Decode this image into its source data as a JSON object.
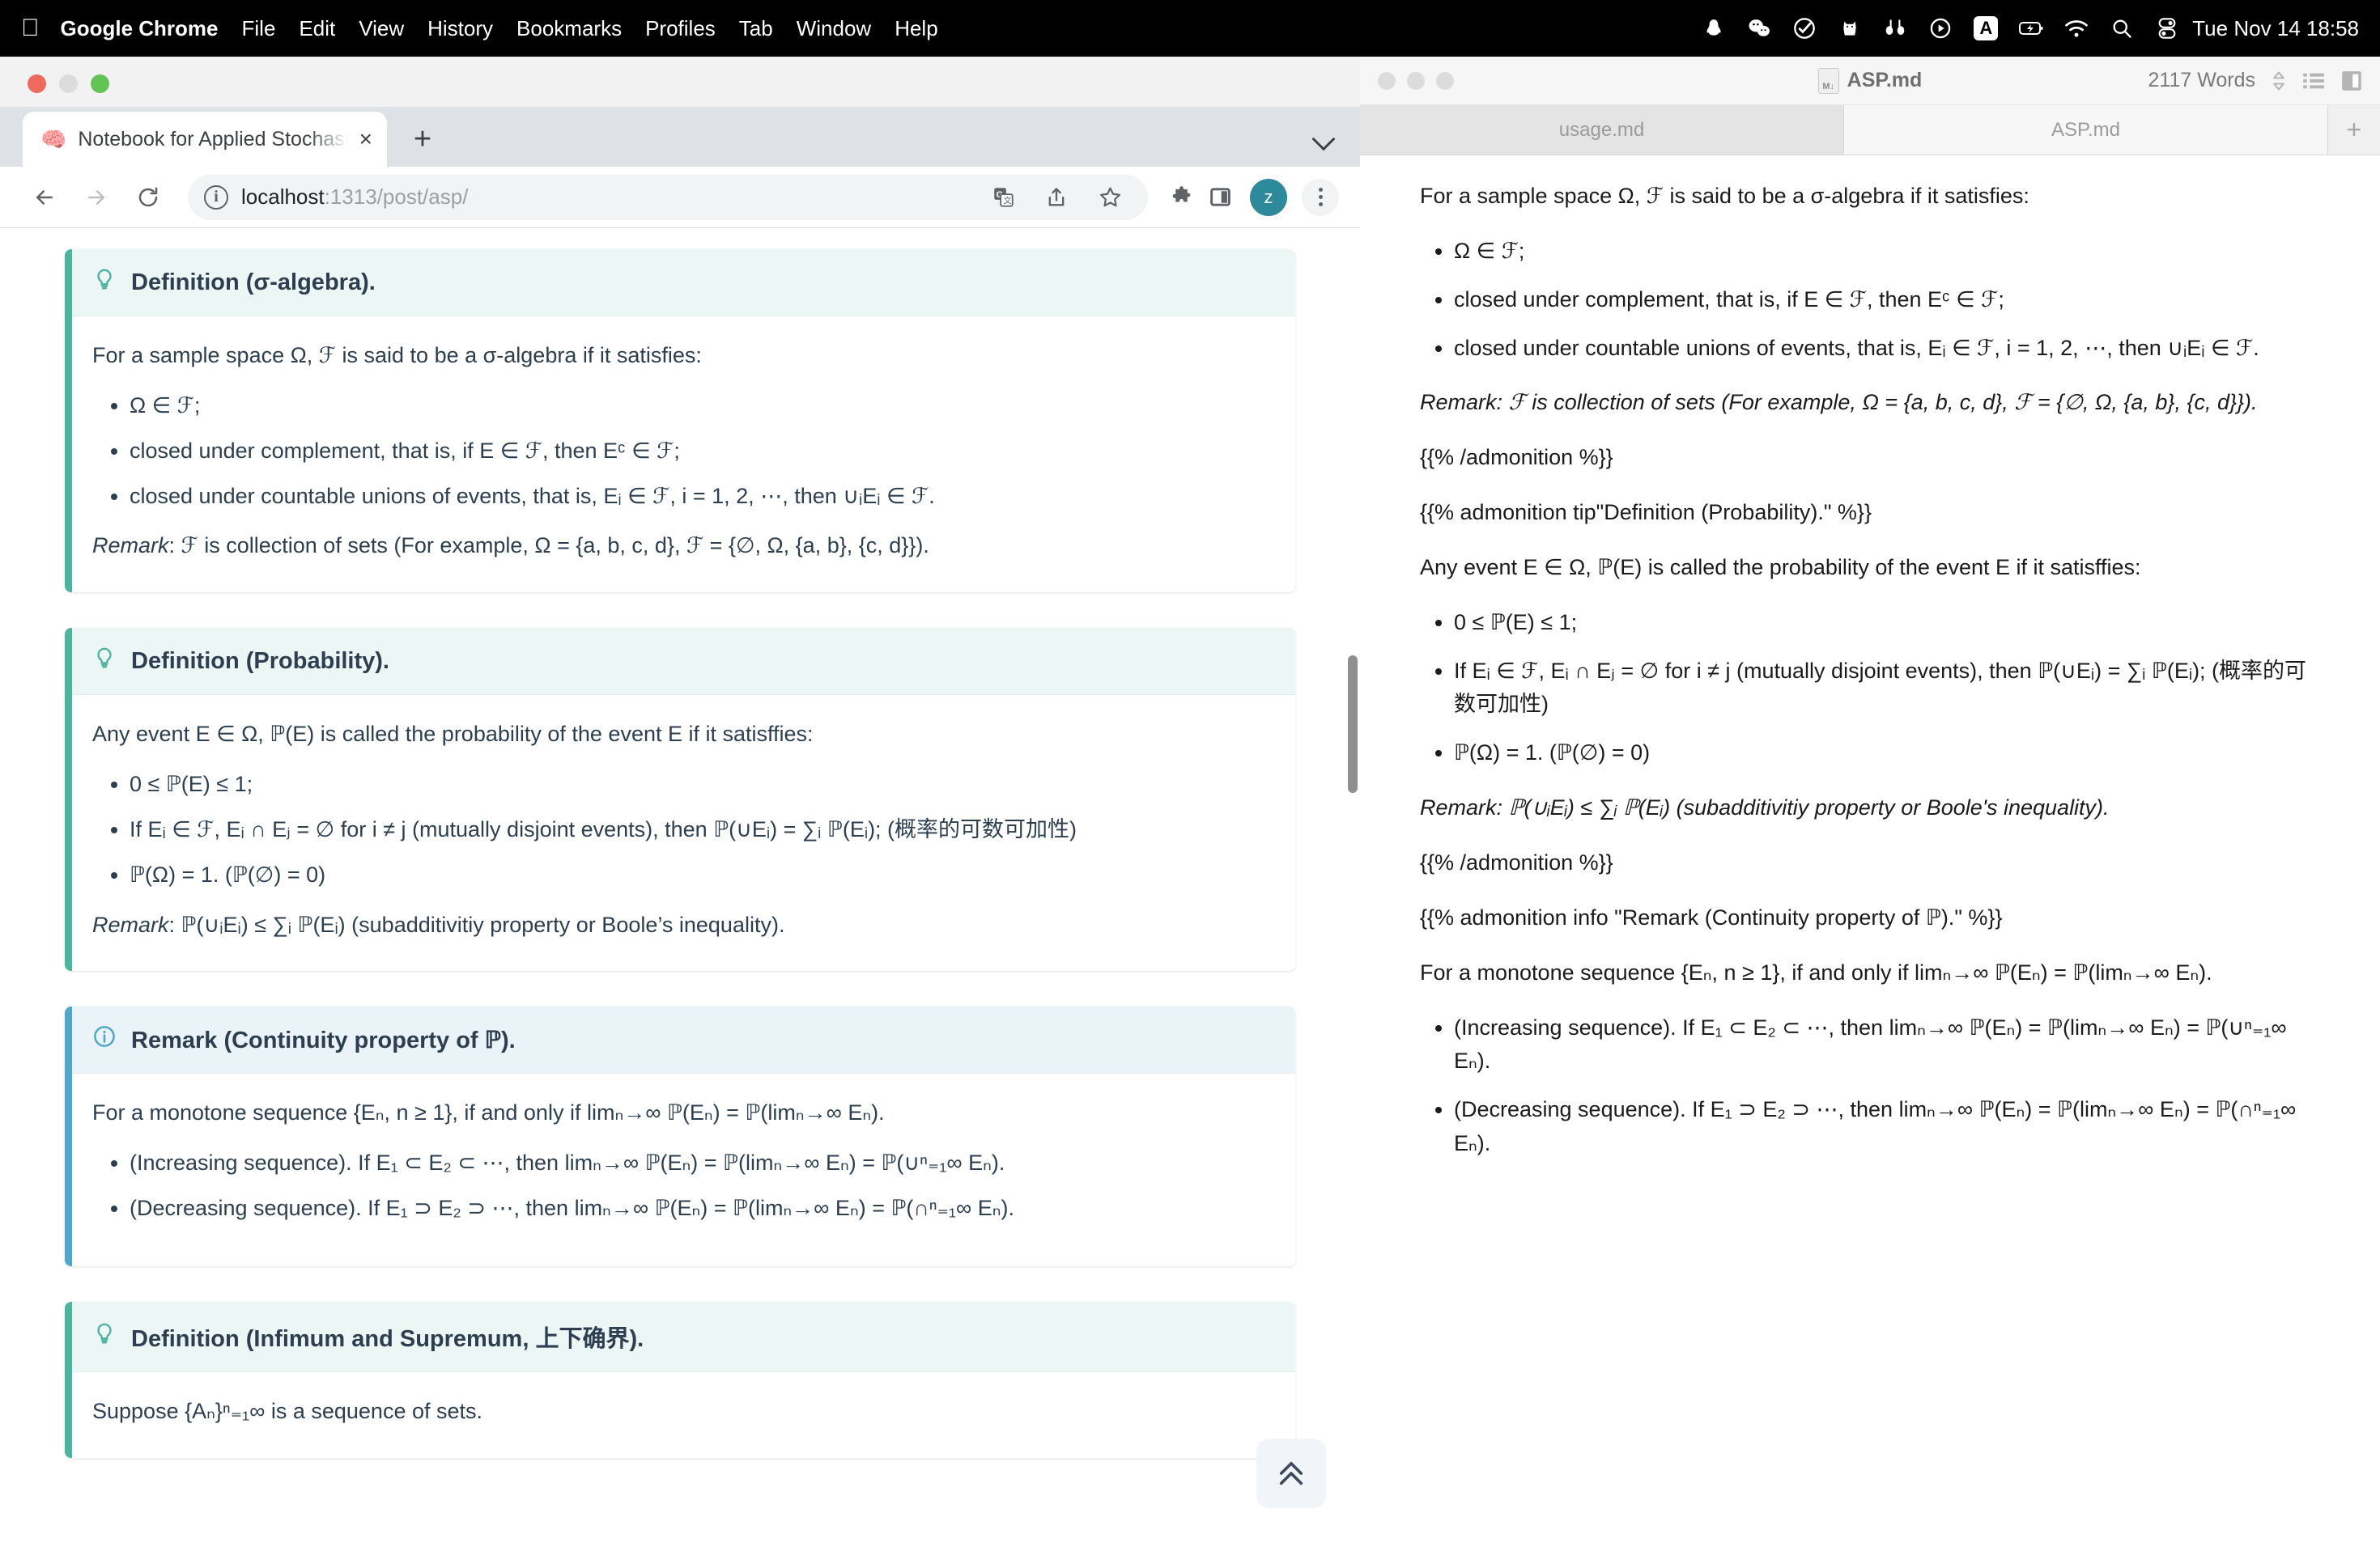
{
  "menubar": {
    "apple_icon": "apple-icon",
    "items": [
      {
        "label": "Google Chrome",
        "bold": true
      },
      {
        "label": "File",
        "bold": false
      },
      {
        "label": "Edit",
        "bold": false
      },
      {
        "label": "View",
        "bold": false
      },
      {
        "label": "History",
        "bold": false
      },
      {
        "label": "Bookmarks",
        "bold": false
      },
      {
        "label": "Profiles",
        "bold": false
      },
      {
        "label": "Tab",
        "bold": false
      },
      {
        "label": "Window",
        "bold": false
      },
      {
        "label": "Help",
        "bold": false
      }
    ],
    "tray_icons": [
      "qq-penguin-icon",
      "wechat-icon",
      "checkmark-circle-icon",
      "cat-icon",
      "earbuds-icon",
      "play-circle-icon",
      "input-source-a-icon",
      "battery-charging-icon",
      "wifi-icon",
      "spotlight-search-icon",
      "control-center-icon"
    ],
    "input_source": "A",
    "clock": "Tue Nov 14  18:58"
  },
  "chrome": {
    "tab": {
      "favicon": "brain-icon",
      "title": "Notebook for Applied Stochast",
      "close_label": "×"
    },
    "new_tab_label": "+",
    "tabstrip_chevron": "⌄",
    "toolbar": {
      "back": "←",
      "forward": "→",
      "reload": "↻",
      "url_host": "localhost",
      "url_path": ":1313/post/asp/",
      "icons": [
        "translate-icon",
        "share-icon",
        "bookmark-star-icon",
        "extensions-puzzle-icon",
        "side-panel-icon"
      ],
      "avatar_initial": "z"
    }
  },
  "page": {
    "blocks": [
      {
        "kind": "tip",
        "icon": "lightbulb-icon",
        "title": "Definition (σ-algebra).",
        "intro": "For a sample space Ω, ℱ is said to be a σ-algebra if it satisfies:",
        "bullets": [
          "Ω ∈ ℱ;",
          "closed under complement, that is, if E ∈ ℱ, then Eᶜ ∈ ℱ;",
          "closed under countable unions of events, that is, Eᵢ ∈ ℱ, i = 1, 2, ⋯, then ∪ᵢEᵢ ∈ ℱ."
        ],
        "remark_label": "Remark",
        "remark": ": ℱ is collection of sets (For example, Ω = {a, b, c, d}, ℱ = {∅, Ω, {a, b}, {c, d}})."
      },
      {
        "kind": "tip",
        "icon": "lightbulb-icon",
        "title": "Definition (Probability).",
        "intro": "Any event E ∈ Ω, ℙ(E) is called the probability of the event E if it satisffies:",
        "bullets": [
          "0 ≤ ℙ(E) ≤ 1;",
          "If Eᵢ ∈ ℱ, Eᵢ ∩ Eⱼ = ∅ for i ≠ j (mutually disjoint events), then ℙ(∪Eᵢ) = ∑ᵢ ℙ(Eᵢ); (概率的可数可加性)",
          "ℙ(Ω) = 1. (ℙ(∅) = 0)"
        ],
        "remark_label": "Remark",
        "remark": ": ℙ(∪ᵢEᵢ) ≤ ∑ᵢ ℙ(Eᵢ) (subadditivitiy property or Boole’s inequality)."
      },
      {
        "kind": "info",
        "icon": "info-circle-icon",
        "title": "Remark (Continuity property of ℙ).",
        "intro": "For a monotone sequence {Eₙ, n ≥ 1}, if and only if limₙ→∞ ℙ(Eₙ) = ℙ(limₙ→∞ Eₙ).",
        "bullets": [
          "(Increasing sequence). If E₁ ⊂ E₂ ⊂ ⋯, then limₙ→∞ ℙ(Eₙ) = ℙ(limₙ→∞ Eₙ) = ℙ(∪ⁿ₌₁∞ Eₙ).",
          "(Decreasing sequence). If E₁ ⊃ E₂ ⊃ ⋯, then limₙ→∞ ℙ(Eₙ) = ℙ(limₙ→∞ Eₙ) = ℙ(∩ⁿ₌₁∞ Eₙ)."
        ]
      },
      {
        "kind": "tip",
        "icon": "lightbulb-icon",
        "title": "Definition (Infimum and Supremum, 上下确界).",
        "intro": "Suppose {Aₙ}ⁿ₌₁∞ is a sequence of sets."
      }
    ],
    "scroll_to_top": "scroll-to-top-icon"
  },
  "editor": {
    "title": "ASP.md",
    "doc_icon": "markdown-file-icon",
    "word_count": "2117 Words",
    "sort_icon": "sort-updown-icon",
    "outline_icon": "outline-list-icon",
    "sidebar_icon": "sidebar-toggle-icon",
    "tabs": [
      {
        "label": "usage.md",
        "active": false
      },
      {
        "label": "ASP.md",
        "active": true
      }
    ],
    "new_tab_label": "+",
    "lines": [
      {
        "type": "p",
        "text": "For a sample space Ω, ℱ is said to be a σ-algebra if it satisfies:"
      },
      {
        "type": "ul",
        "items": [
          "Ω ∈ ℱ;",
          "closed under complement, that is, if E ∈ ℱ, then Eᶜ ∈ ℱ;",
          "closed under countable unions of events, that is, Eᵢ ∈ ℱ, i = 1, 2, ⋯, then ∪ᵢEᵢ ∈ ℱ."
        ]
      },
      {
        "type": "p",
        "text": "Remark: ℱ is collection of sets (For example, Ω = {a, b, c, d}, ℱ = {∅, Ω, {a, b}, {c, d}})."
      },
      {
        "type": "p",
        "text": "{{% /admonition %}}"
      },
      {
        "type": "p",
        "text": "{{% admonition tip\"Definition (Probability).\" %}}"
      },
      {
        "type": "p",
        "text": "Any event E ∈ Ω, ℙ(E) is called the probability of the event E if it satisffies:"
      },
      {
        "type": "ul",
        "items": [
          "0 ≤ ℙ(E) ≤ 1;",
          "If Eᵢ ∈ ℱ, Eᵢ ∩ Eⱼ = ∅ for i ≠ j (mutually disjoint events), then ℙ(∪Eᵢ) = ∑ᵢ ℙ(Eᵢ); (概率的可数可加性)",
          "ℙ(Ω) = 1. (ℙ(∅) = 0)"
        ]
      },
      {
        "type": "p",
        "text": "Remark: ℙ(∪ᵢEᵢ) ≤ ∑ᵢ ℙ(Eᵢ) (subadditivitiy property or Boole's inequality)."
      },
      {
        "type": "p",
        "text": "{{% /admonition %}}"
      },
      {
        "type": "p",
        "text": "{{% admonition info \"Remark (Continuity property of ℙ).\" %}}"
      },
      {
        "type": "p",
        "text": "For a monotone sequence {Eₙ, n ≥ 1}, if and only if limₙ→∞ ℙ(Eₙ) = ℙ(limₙ→∞ Eₙ)."
      },
      {
        "type": "ul",
        "items": [
          "(Increasing sequence). If E₁ ⊂ E₂ ⊂ ⋯, then limₙ→∞ ℙ(Eₙ) = ℙ(limₙ→∞ Eₙ) = ℙ(∪ⁿ₌₁∞ Eₙ).",
          "(Decreasing sequence). If E₁ ⊃ E₂ ⊃ ⋯, then limₙ→∞ ℙ(Eₙ) = ℙ(limₙ→∞ Eₙ) = ℙ(∩ⁿ₌₁∞ Eₙ)."
        ]
      }
    ]
  },
  "colors": {
    "tip_border": "#4cb5a0",
    "tip_header": "#ecf6f4",
    "info_border": "#4fa8cc",
    "info_header": "#eaf3f8",
    "text": "#2c3e50",
    "avatar": "#2c8a9b"
  }
}
